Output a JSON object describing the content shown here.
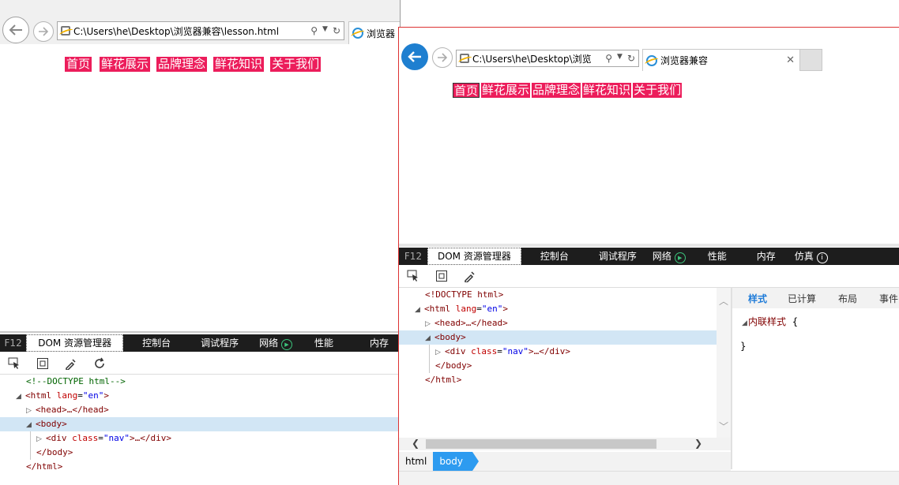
{
  "window1": {
    "address": "C:\\Users\\he\\Desktop\\浏览器兼容\\lesson.html",
    "tab_title": "浏览器",
    "nav": [
      "首页",
      "鲜花展示",
      "品牌理念",
      "鲜花知识",
      "关于我们"
    ],
    "devtools": {
      "f12": "F12",
      "tabs": [
        "DOM 资源管理器",
        "控制台",
        "调试程序",
        "网络",
        "性能",
        "内存"
      ],
      "tree": {
        "doctype": "<!--DOCTYPE html-->",
        "html_open": "<html",
        "html_attr": "lang",
        "html_val": "\"en\"",
        "head": "<head>…</head>",
        "body_open": "<body>",
        "div_open": "<div",
        "div_attr": "class",
        "div_val": "\"nav\"",
        "div_close": ">…</div>",
        "body_close": "</body>",
        "html_close": "</html>"
      }
    }
  },
  "window2": {
    "address": "C:\\Users\\he\\Desktop\\浏览",
    "tab_title": "浏览器兼容",
    "nav": [
      "首页",
      "鲜花展示",
      "品牌理念",
      "鲜花知识",
      "关于我们"
    ],
    "devtools": {
      "f12": "F12",
      "tabs": [
        "DOM 资源管理器",
        "控制台",
        "调试程序",
        "网络",
        "性能",
        "内存",
        "仿真"
      ],
      "tree": {
        "doctype": "<!DOCTYPE html>",
        "html_open": "<html",
        "html_attr": "lang",
        "html_val": "\"en\"",
        "head": "<head>…</head>",
        "body_open": "<body>",
        "div_open": "<div",
        "div_attr": "class",
        "div_val": "\"nav\"",
        "div_close": ">…</div>",
        "body_close": "</body>",
        "html_close": "</html>"
      },
      "styles_tabs": [
        "样式",
        "已计算",
        "布局",
        "事件"
      ],
      "inline_style_label": "内联样式",
      "open_brace": "{",
      "close_brace": "}",
      "breadcrumbs": [
        "html",
        "body"
      ]
    }
  },
  "colors": {
    "nav_bg": "#ec1d5b",
    "accent": "#1e7bd8",
    "back_button": "#1e7fd0"
  }
}
